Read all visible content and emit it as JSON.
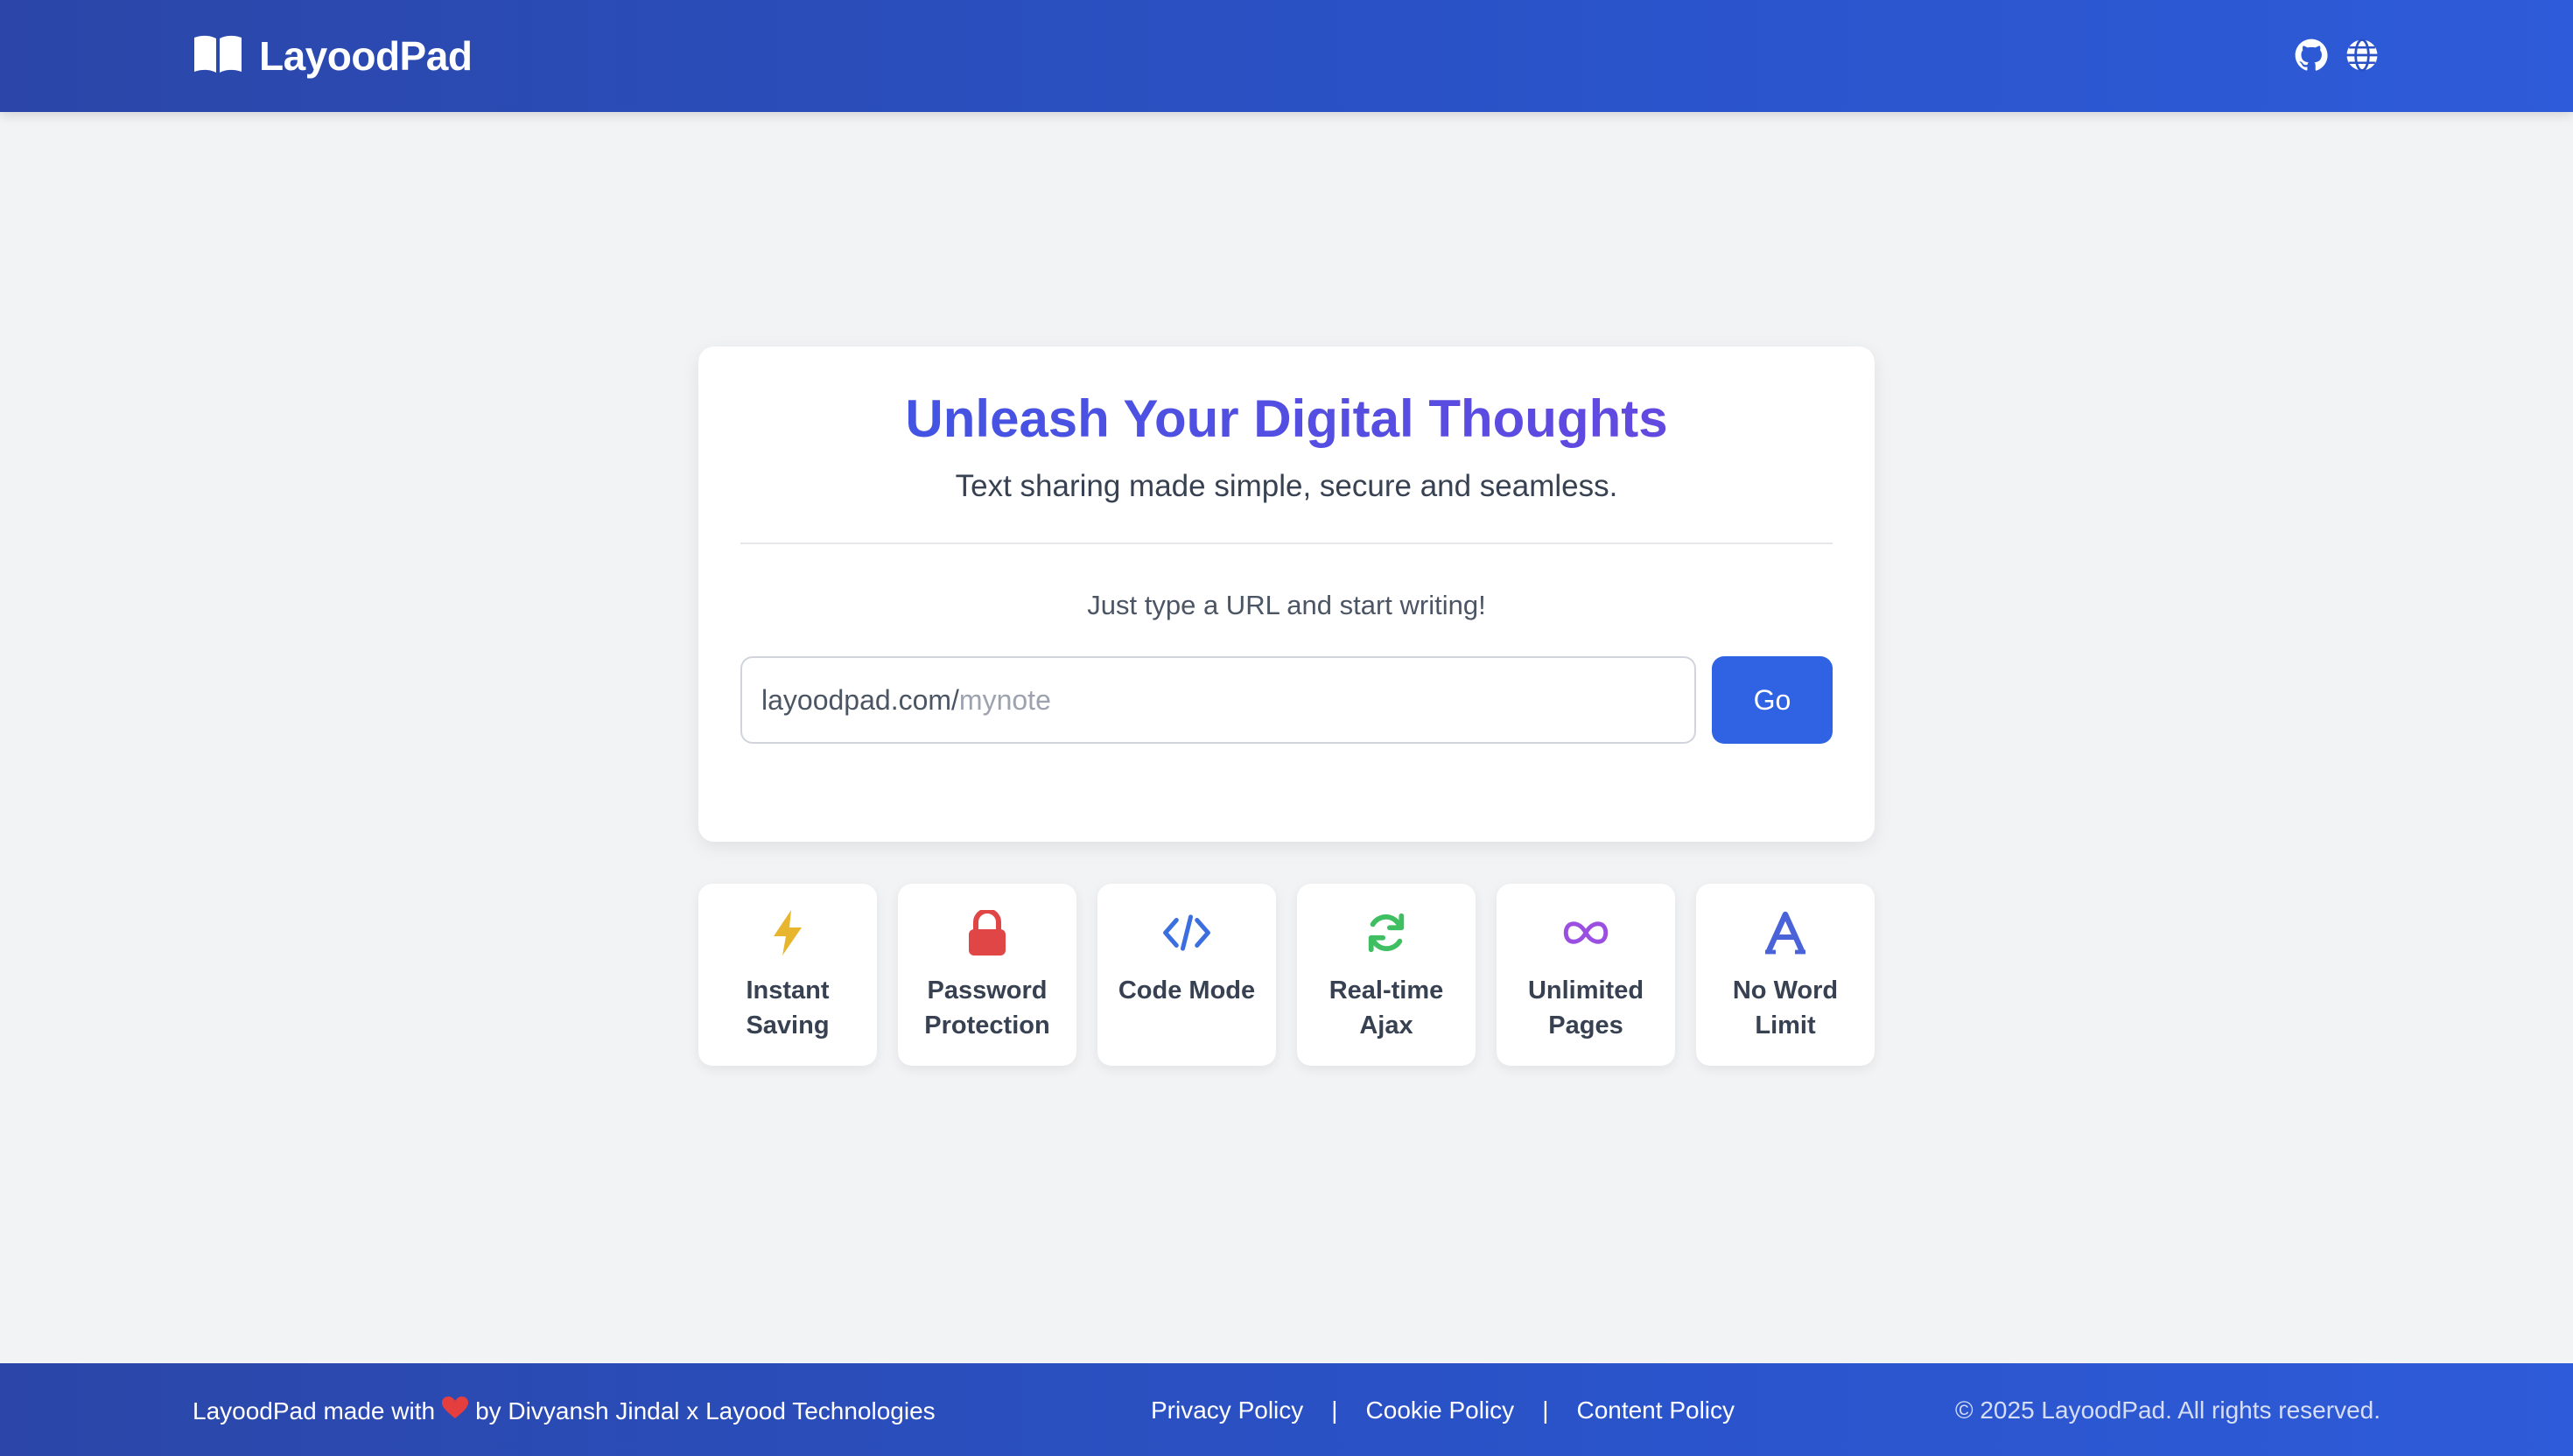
{
  "header": {
    "brand": "LayoodPad",
    "icons": [
      "github-icon",
      "globe-icon"
    ]
  },
  "hero": {
    "title": "Unleash Your Digital Thoughts",
    "subtitle": "Text sharing made simple, secure and seamless.",
    "prompt": "Just type a URL and start writing!",
    "url_prefix": "layoodpad.com/",
    "url_placeholder": "mynote",
    "url_value": "",
    "go_label": "Go"
  },
  "features": [
    {
      "icon": "bolt-icon",
      "line1": "Instant",
      "line2": "Saving",
      "color": "#e8b52f"
    },
    {
      "icon": "lock-icon",
      "line1": "Password",
      "line2": "Protection",
      "color": "#e04646"
    },
    {
      "icon": "code-icon",
      "line1": "Code Mode",
      "line2": "",
      "color": "#3b6fe0"
    },
    {
      "icon": "sync-icon",
      "line1": "Real-time",
      "line2": "Ajax",
      "color": "#3fbf62"
    },
    {
      "icon": "infinity-icon",
      "line1": "Unlimited",
      "line2": "Pages",
      "color": "#9b4fe0"
    },
    {
      "icon": "font-icon",
      "line1": "No Word",
      "line2": "Limit",
      "color": "#4a63d8"
    }
  ],
  "footer": {
    "credit_prefix": "LayoodPad made with",
    "credit_suffix": "by Divyansh Jindal x Layood Technologies",
    "links": [
      "Privacy Policy",
      "Cookie Policy",
      "Content Policy"
    ],
    "separator": "|",
    "copyright": "© 2025 LayoodPad. All rights reserved."
  },
  "colors": {
    "header_bg": "#2a4fc0",
    "accent": "#2f63e3",
    "page_bg": "#f2f3f5",
    "heart": "#e53e3e"
  }
}
